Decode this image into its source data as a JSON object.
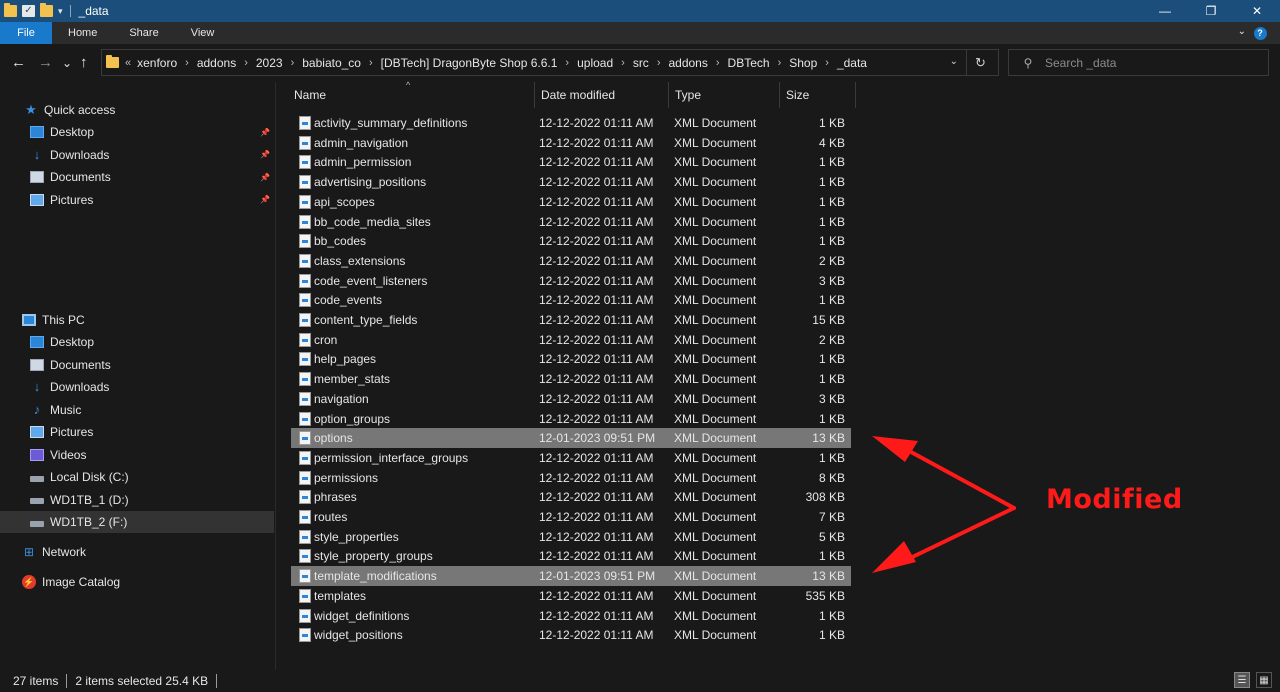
{
  "window": {
    "title": "_data",
    "controls": {
      "minimize": "—",
      "maximize": "❐",
      "close": "✕"
    }
  },
  "ribbon": {
    "tabs": [
      "File",
      "Home",
      "Share",
      "View"
    ],
    "help": "?"
  },
  "nav": {
    "back": "←",
    "forward": "→",
    "recent": "⌄",
    "up": "↑",
    "breadcrumb_lead": "«",
    "breadcrumbs": [
      "xenforo",
      "addons",
      "2023",
      "babiato_co",
      "[DBTech] DragonByte Shop 6.6.1",
      "upload",
      "src",
      "addons",
      "DBTech",
      "Shop",
      "_data"
    ],
    "search_placeholder": "Search _data"
  },
  "sidebar": {
    "quick_access": {
      "label": "Quick access",
      "items": [
        {
          "label": "Desktop",
          "icon": "desktop-icon",
          "pinned": true
        },
        {
          "label": "Downloads",
          "icon": "downloads-icon",
          "pinned": true
        },
        {
          "label": "Documents",
          "icon": "documents-icon",
          "pinned": true
        },
        {
          "label": "Pictures",
          "icon": "pictures-icon",
          "pinned": true
        }
      ]
    },
    "this_pc": {
      "label": "This PC",
      "items": [
        {
          "label": "Desktop",
          "icon": "desktop-icon"
        },
        {
          "label": "Documents",
          "icon": "documents-icon"
        },
        {
          "label": "Downloads",
          "icon": "downloads-icon"
        },
        {
          "label": "Music",
          "icon": "music-icon"
        },
        {
          "label": "Pictures",
          "icon": "pictures-icon"
        },
        {
          "label": "Videos",
          "icon": "videos-icon"
        },
        {
          "label": "Local Disk (C:)",
          "icon": "drive-icon"
        },
        {
          "label": "WD1TB_1 (D:)",
          "icon": "drive-icon"
        },
        {
          "label": "WD1TB_2 (F:)",
          "icon": "drive-icon",
          "selected": true
        }
      ]
    },
    "network": "Network",
    "image_catalog": "Image Catalog"
  },
  "columns": [
    "Name",
    "Date modified",
    "Type",
    "Size"
  ],
  "files": [
    {
      "name": "activity_summary_definitions",
      "date": "12-12-2022 01:11 AM",
      "type": "XML Document",
      "size": "1 KB",
      "selected": false
    },
    {
      "name": "admin_navigation",
      "date": "12-12-2022 01:11 AM",
      "type": "XML Document",
      "size": "4 KB",
      "selected": false
    },
    {
      "name": "admin_permission",
      "date": "12-12-2022 01:11 AM",
      "type": "XML Document",
      "size": "1 KB",
      "selected": false
    },
    {
      "name": "advertising_positions",
      "date": "12-12-2022 01:11 AM",
      "type": "XML Document",
      "size": "1 KB",
      "selected": false
    },
    {
      "name": "api_scopes",
      "date": "12-12-2022 01:11 AM",
      "type": "XML Document",
      "size": "1 KB",
      "selected": false
    },
    {
      "name": "bb_code_media_sites",
      "date": "12-12-2022 01:11 AM",
      "type": "XML Document",
      "size": "1 KB",
      "selected": false
    },
    {
      "name": "bb_codes",
      "date": "12-12-2022 01:11 AM",
      "type": "XML Document",
      "size": "1 KB",
      "selected": false
    },
    {
      "name": "class_extensions",
      "date": "12-12-2022 01:11 AM",
      "type": "XML Document",
      "size": "2 KB",
      "selected": false
    },
    {
      "name": "code_event_listeners",
      "date": "12-12-2022 01:11 AM",
      "type": "XML Document",
      "size": "3 KB",
      "selected": false
    },
    {
      "name": "code_events",
      "date": "12-12-2022 01:11 AM",
      "type": "XML Document",
      "size": "1 KB",
      "selected": false
    },
    {
      "name": "content_type_fields",
      "date": "12-12-2022 01:11 AM",
      "type": "XML Document",
      "size": "15 KB",
      "selected": false
    },
    {
      "name": "cron",
      "date": "12-12-2022 01:11 AM",
      "type": "XML Document",
      "size": "2 KB",
      "selected": false
    },
    {
      "name": "help_pages",
      "date": "12-12-2022 01:11 AM",
      "type": "XML Document",
      "size": "1 KB",
      "selected": false
    },
    {
      "name": "member_stats",
      "date": "12-12-2022 01:11 AM",
      "type": "XML Document",
      "size": "1 KB",
      "selected": false
    },
    {
      "name": "navigation",
      "date": "12-12-2022 01:11 AM",
      "type": "XML Document",
      "size": "3 KB",
      "selected": false
    },
    {
      "name": "option_groups",
      "date": "12-12-2022 01:11 AM",
      "type": "XML Document",
      "size": "1 KB",
      "selected": false
    },
    {
      "name": "options",
      "date": "12-01-2023 09:51 PM",
      "type": "XML Document",
      "size": "13 KB",
      "selected": true
    },
    {
      "name": "permission_interface_groups",
      "date": "12-12-2022 01:11 AM",
      "type": "XML Document",
      "size": "1 KB",
      "selected": false
    },
    {
      "name": "permissions",
      "date": "12-12-2022 01:11 AM",
      "type": "XML Document",
      "size": "8 KB",
      "selected": false
    },
    {
      "name": "phrases",
      "date": "12-12-2022 01:11 AM",
      "type": "XML Document",
      "size": "308 KB",
      "selected": false
    },
    {
      "name": "routes",
      "date": "12-12-2022 01:11 AM",
      "type": "XML Document",
      "size": "7 KB",
      "selected": false
    },
    {
      "name": "style_properties",
      "date": "12-12-2022 01:11 AM",
      "type": "XML Document",
      "size": "5 KB",
      "selected": false
    },
    {
      "name": "style_property_groups",
      "date": "12-12-2022 01:11 AM",
      "type": "XML Document",
      "size": "1 KB",
      "selected": false
    },
    {
      "name": "template_modifications",
      "date": "12-01-2023 09:51 PM",
      "type": "XML Document",
      "size": "13 KB",
      "selected": true
    },
    {
      "name": "templates",
      "date": "12-12-2022 01:11 AM",
      "type": "XML Document",
      "size": "535 KB",
      "selected": false
    },
    {
      "name": "widget_definitions",
      "date": "12-12-2022 01:11 AM",
      "type": "XML Document",
      "size": "1 KB",
      "selected": false
    },
    {
      "name": "widget_positions",
      "date": "12-12-2022 01:11 AM",
      "type": "XML Document",
      "size": "1 KB",
      "selected": false
    }
  ],
  "annotation": {
    "label": "Modified",
    "color": "#ff1a1a"
  },
  "status": {
    "items": "27 items",
    "selected": "2 items selected  25.4 KB"
  },
  "colors": {
    "titlebar": "#1b4e7a",
    "file_tab": "#1979ca",
    "selection": "#777777",
    "background": "#191919"
  }
}
